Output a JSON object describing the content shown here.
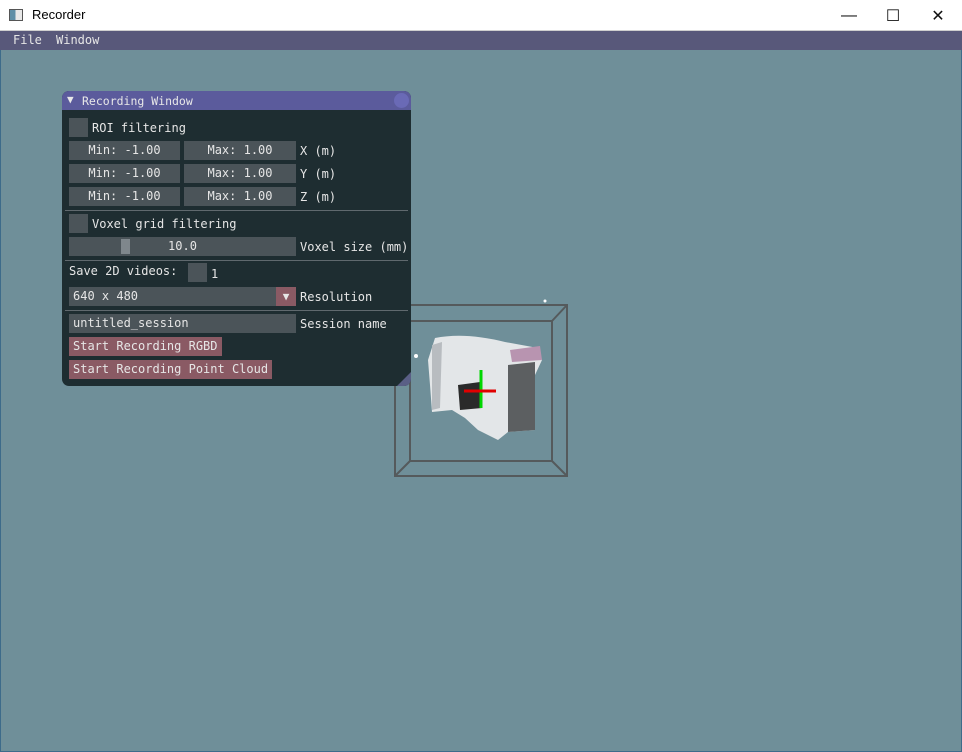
{
  "window": {
    "title": "Recorder",
    "controls": {
      "minimize": "—",
      "maximize": "☐",
      "close": "✕"
    }
  },
  "menu": {
    "items": [
      "File",
      "Window"
    ]
  },
  "panel": {
    "title": "Recording Window",
    "roi": {
      "label": "ROI filtering",
      "rows": [
        {
          "min": "Min: -1.00",
          "max": "Max: 1.00",
          "axis": "X (m)"
        },
        {
          "min": "Min: -1.00",
          "max": "Max: 1.00",
          "axis": "Y (m)"
        },
        {
          "min": "Min: -1.00",
          "max": "Max: 1.00",
          "axis": "Z (m)"
        }
      ]
    },
    "voxel": {
      "label": "Voxel grid filtering",
      "value": "10.0",
      "size_label": "Voxel size (mm)"
    },
    "save2d": {
      "label": "Save 2D videos:",
      "value": "1"
    },
    "resolution": {
      "value": "640 x 480",
      "label": "Resolution"
    },
    "session": {
      "value": "untitled_session",
      "label": "Session name"
    },
    "buttons": {
      "rgbd": "Start Recording RGBD",
      "pointcloud": "Start Recording Point Cloud"
    }
  },
  "colors": {
    "background": "#6f8f99",
    "menubar": "#58587a",
    "panel": "#1e2d31",
    "header": "#5b5b9c",
    "button": "#8a5a64",
    "field": "#4b5459"
  }
}
